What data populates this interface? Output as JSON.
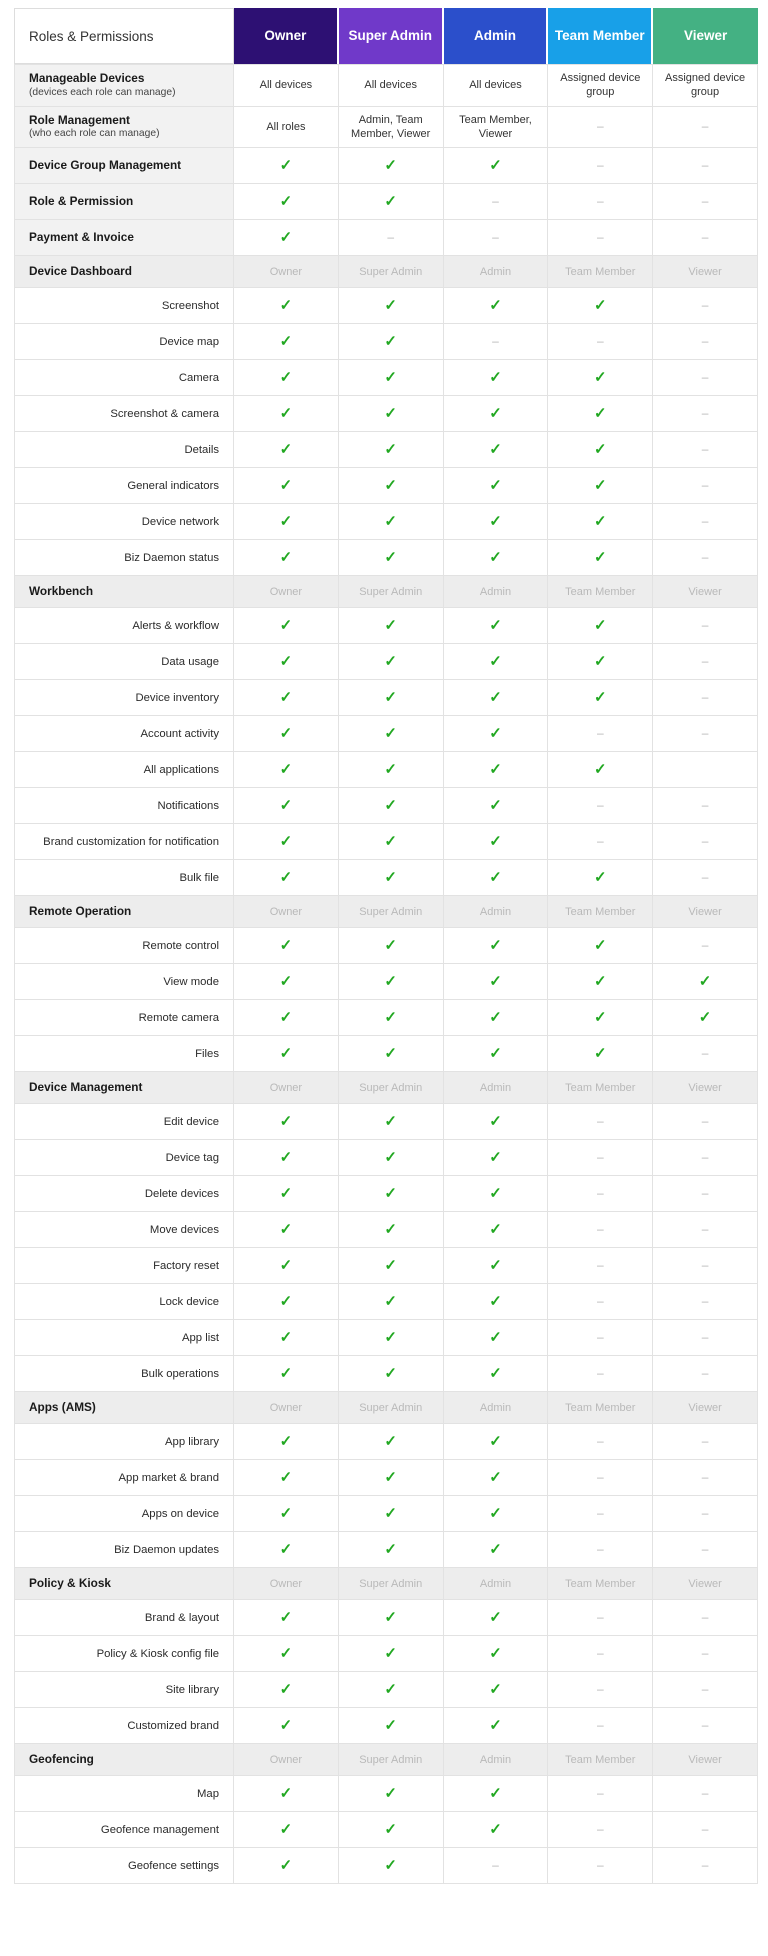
{
  "table": {
    "corner_label": "Roles & Permissions",
    "roles": [
      {
        "label": "Owner",
        "color": "#2d1073"
      },
      {
        "label": "Super Admin",
        "color": "#7039c9"
      },
      {
        "label": "Admin",
        "color": "#2b4fcb"
      },
      {
        "label": "Team Member",
        "color": "#18a0e8"
      },
      {
        "label": "Viewer",
        "color": "#44b183"
      }
    ],
    "glyphs": {
      "check": "✓",
      "dash": "–",
      "blank": ""
    },
    "rows": [
      {
        "kind": "top",
        "label": "Manageable Devices",
        "sublabel": "(devices each role can manage)",
        "values": [
          "All devices",
          "All devices",
          "All devices",
          "Assigned device group",
          "Assigned device group"
        ]
      },
      {
        "kind": "top",
        "label": "Role Management",
        "sublabel": "(who each role can manage)",
        "values": [
          "All roles",
          "Admin, Team Member, Viewer",
          "Team Member, Viewer",
          "dash",
          "dash"
        ]
      },
      {
        "kind": "top",
        "label": "Device Group Management",
        "sublabel": "",
        "values": [
          "check",
          "check",
          "check",
          "dash",
          "dash"
        ]
      },
      {
        "kind": "top",
        "label": "Role & Permission",
        "sublabel": "",
        "values": [
          "check",
          "check",
          "dash",
          "dash",
          "dash"
        ]
      },
      {
        "kind": "top",
        "label": "Payment & Invoice",
        "sublabel": "",
        "values": [
          "check",
          "dash",
          "dash",
          "dash",
          "dash"
        ]
      },
      {
        "kind": "section",
        "label": "Device Dashboard",
        "values": [
          "Owner",
          "Super Admin",
          "Admin",
          "Team Member",
          "Viewer"
        ]
      },
      {
        "kind": "sub",
        "label": "Screenshot",
        "values": [
          "check",
          "check",
          "check",
          "check",
          "dash"
        ]
      },
      {
        "kind": "sub",
        "label": "Device map",
        "values": [
          "check",
          "check",
          "dash",
          "dash",
          "dash"
        ]
      },
      {
        "kind": "sub",
        "label": "Camera",
        "values": [
          "check",
          "check",
          "check",
          "check",
          "dash"
        ]
      },
      {
        "kind": "sub",
        "label": "Screenshot & camera",
        "values": [
          "check",
          "check",
          "check",
          "check",
          "dash"
        ]
      },
      {
        "kind": "sub",
        "label": "Details",
        "values": [
          "check",
          "check",
          "check",
          "check",
          "dash"
        ]
      },
      {
        "kind": "sub",
        "label": "General indicators",
        "values": [
          "check",
          "check",
          "check",
          "check",
          "dash"
        ]
      },
      {
        "kind": "sub",
        "label": "Device network",
        "values": [
          "check",
          "check",
          "check",
          "check",
          "dash"
        ]
      },
      {
        "kind": "sub",
        "label": "Biz Daemon status",
        "values": [
          "check",
          "check",
          "check",
          "check",
          "dash"
        ]
      },
      {
        "kind": "section",
        "label": "Workbench",
        "values": [
          "Owner",
          "Super Admin",
          "Admin",
          "Team Member",
          "Viewer"
        ]
      },
      {
        "kind": "sub",
        "label": "Alerts & workflow",
        "values": [
          "check",
          "check",
          "check",
          "check",
          "dash"
        ]
      },
      {
        "kind": "sub",
        "label": "Data usage",
        "values": [
          "check",
          "check",
          "check",
          "check",
          "dash"
        ]
      },
      {
        "kind": "sub",
        "label": "Device inventory",
        "values": [
          "check",
          "check",
          "check",
          "check",
          "dash"
        ]
      },
      {
        "kind": "sub",
        "label": "Account activity",
        "values": [
          "check",
          "check",
          "check",
          "dash",
          "dash"
        ]
      },
      {
        "kind": "sub",
        "label": "All applications",
        "values": [
          "check",
          "check",
          "check",
          "check",
          "blank"
        ]
      },
      {
        "kind": "sub",
        "label": "Notifications",
        "values": [
          "check",
          "check",
          "check",
          "dash",
          "dash"
        ]
      },
      {
        "kind": "sub",
        "label": "Brand customization for notification",
        "values": [
          "check",
          "check",
          "check",
          "dash",
          "dash"
        ]
      },
      {
        "kind": "sub",
        "label": "Bulk file",
        "values": [
          "check",
          "check",
          "check",
          "check",
          "dash"
        ]
      },
      {
        "kind": "section",
        "label": "Remote Operation",
        "values": [
          "Owner",
          "Super Admin",
          "Admin",
          "Team Member",
          "Viewer"
        ]
      },
      {
        "kind": "sub",
        "label": "Remote control",
        "values": [
          "check",
          "check",
          "check",
          "check",
          "dash"
        ]
      },
      {
        "kind": "sub",
        "label": "View mode",
        "values": [
          "check",
          "check",
          "check",
          "check",
          "check"
        ]
      },
      {
        "kind": "sub",
        "label": "Remote camera",
        "values": [
          "check",
          "check",
          "check",
          "check",
          "check"
        ]
      },
      {
        "kind": "sub",
        "label": "Files",
        "values": [
          "check",
          "check",
          "check",
          "check",
          "dash"
        ]
      },
      {
        "kind": "section",
        "label": "Device Management",
        "values": [
          "Owner",
          "Super Admin",
          "Admin",
          "Team Member",
          "Viewer"
        ]
      },
      {
        "kind": "sub",
        "label": "Edit device",
        "values": [
          "check",
          "check",
          "check",
          "dash",
          "dash"
        ]
      },
      {
        "kind": "sub",
        "label": "Device tag",
        "values": [
          "check",
          "check",
          "check",
          "dash",
          "dash"
        ]
      },
      {
        "kind": "sub",
        "label": "Delete devices",
        "values": [
          "check",
          "check",
          "check",
          "dash",
          "dash"
        ]
      },
      {
        "kind": "sub",
        "label": "Move devices",
        "values": [
          "check",
          "check",
          "check",
          "dash",
          "dash"
        ]
      },
      {
        "kind": "sub",
        "label": "Factory reset",
        "values": [
          "check",
          "check",
          "check",
          "dash",
          "dash"
        ]
      },
      {
        "kind": "sub",
        "label": "Lock device",
        "values": [
          "check",
          "check",
          "check",
          "dash",
          "dash"
        ]
      },
      {
        "kind": "sub",
        "label": "App list",
        "values": [
          "check",
          "check",
          "check",
          "dash",
          "dash"
        ]
      },
      {
        "kind": "sub",
        "label": "Bulk operations",
        "values": [
          "check",
          "check",
          "check",
          "dash",
          "dash"
        ]
      },
      {
        "kind": "section",
        "label": "Apps (AMS)",
        "values": [
          "Owner",
          "Super Admin",
          "Admin",
          "Team Member",
          "Viewer"
        ]
      },
      {
        "kind": "sub",
        "label": "App library",
        "values": [
          "check",
          "check",
          "check",
          "dash",
          "dash"
        ]
      },
      {
        "kind": "sub",
        "label": "App market & brand",
        "values": [
          "check",
          "check",
          "check",
          "dash",
          "dash"
        ]
      },
      {
        "kind": "sub",
        "label": "Apps on device",
        "values": [
          "check",
          "check",
          "check",
          "dash",
          "dash"
        ]
      },
      {
        "kind": "sub",
        "label": "Biz Daemon updates",
        "values": [
          "check",
          "check",
          "check",
          "dash",
          "dash"
        ]
      },
      {
        "kind": "section",
        "label": "Policy & Kiosk",
        "values": [
          "Owner",
          "Super Admin",
          "Admin",
          "Team Member",
          "Viewer"
        ]
      },
      {
        "kind": "sub",
        "label": "Brand & layout",
        "values": [
          "check",
          "check",
          "check",
          "dash",
          "dash"
        ]
      },
      {
        "kind": "sub",
        "label": "Policy & Kiosk config file",
        "values": [
          "check",
          "check",
          "check",
          "dash",
          "dash"
        ]
      },
      {
        "kind": "sub",
        "label": "Site library",
        "values": [
          "check",
          "check",
          "check",
          "dash",
          "dash"
        ]
      },
      {
        "kind": "sub",
        "label": "Customized brand",
        "values": [
          "check",
          "check",
          "check",
          "dash",
          "dash"
        ]
      },
      {
        "kind": "section",
        "label": "Geofencing",
        "values": [
          "Owner",
          "Super Admin",
          "Admin",
          "Team Member",
          "Viewer"
        ]
      },
      {
        "kind": "sub",
        "label": "Map",
        "values": [
          "check",
          "check",
          "check",
          "dash",
          "dash"
        ]
      },
      {
        "kind": "sub",
        "label": "Geofence management",
        "values": [
          "check",
          "check",
          "check",
          "dash",
          "dash"
        ]
      },
      {
        "kind": "sub",
        "label": "Geofence settings",
        "values": [
          "check",
          "check",
          "dash",
          "dash",
          "dash"
        ]
      }
    ]
  }
}
